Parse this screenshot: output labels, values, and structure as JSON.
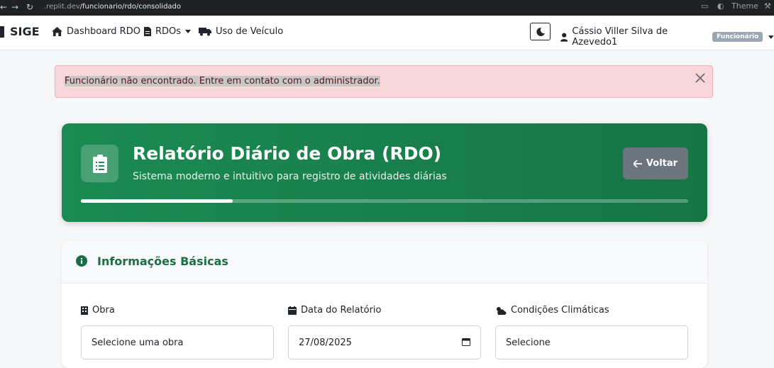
{
  "browser": {
    "url_host": ".replit.dev",
    "url_path": "/funcionario/rdo/consolidado",
    "theme_label": "Theme"
  },
  "nav": {
    "brand": "SIGE",
    "items": [
      {
        "label": "Dashboard RDO",
        "icon": "home-icon"
      },
      {
        "label": "RDOs",
        "icon": "document-icon"
      },
      {
        "label": "Uso de Veículo",
        "icon": "truck-icon"
      }
    ],
    "user_name": "Cássio Viller Silva de Azevedo1",
    "user_badge": "Funcionário"
  },
  "alert": {
    "message": "Funcionário não encontrado. Entre em contato com o administrador."
  },
  "hero": {
    "title": "Relatório Diário de Obra (RDO)",
    "subtitle": "Sistema moderno e intuitivo para registro de atividades diárias",
    "back_label": "Voltar",
    "progress": 0.25
  },
  "section": {
    "title": "Informações Básicas",
    "fields": [
      {
        "label": "Obra",
        "value": "Selecione uma obra",
        "icon": "building-icon"
      },
      {
        "label": "Data do Relatório",
        "value": "27/08/2025",
        "icon": "calendar-icon"
      },
      {
        "label": "Condições Climáticas",
        "value": "Selecione",
        "icon": "weather-icon"
      }
    ]
  },
  "colors": {
    "hero_green": "#1b8a53",
    "section_title": "#1b6e43",
    "alert_bg": "#f8d7da",
    "back_button": "#6c757d"
  }
}
